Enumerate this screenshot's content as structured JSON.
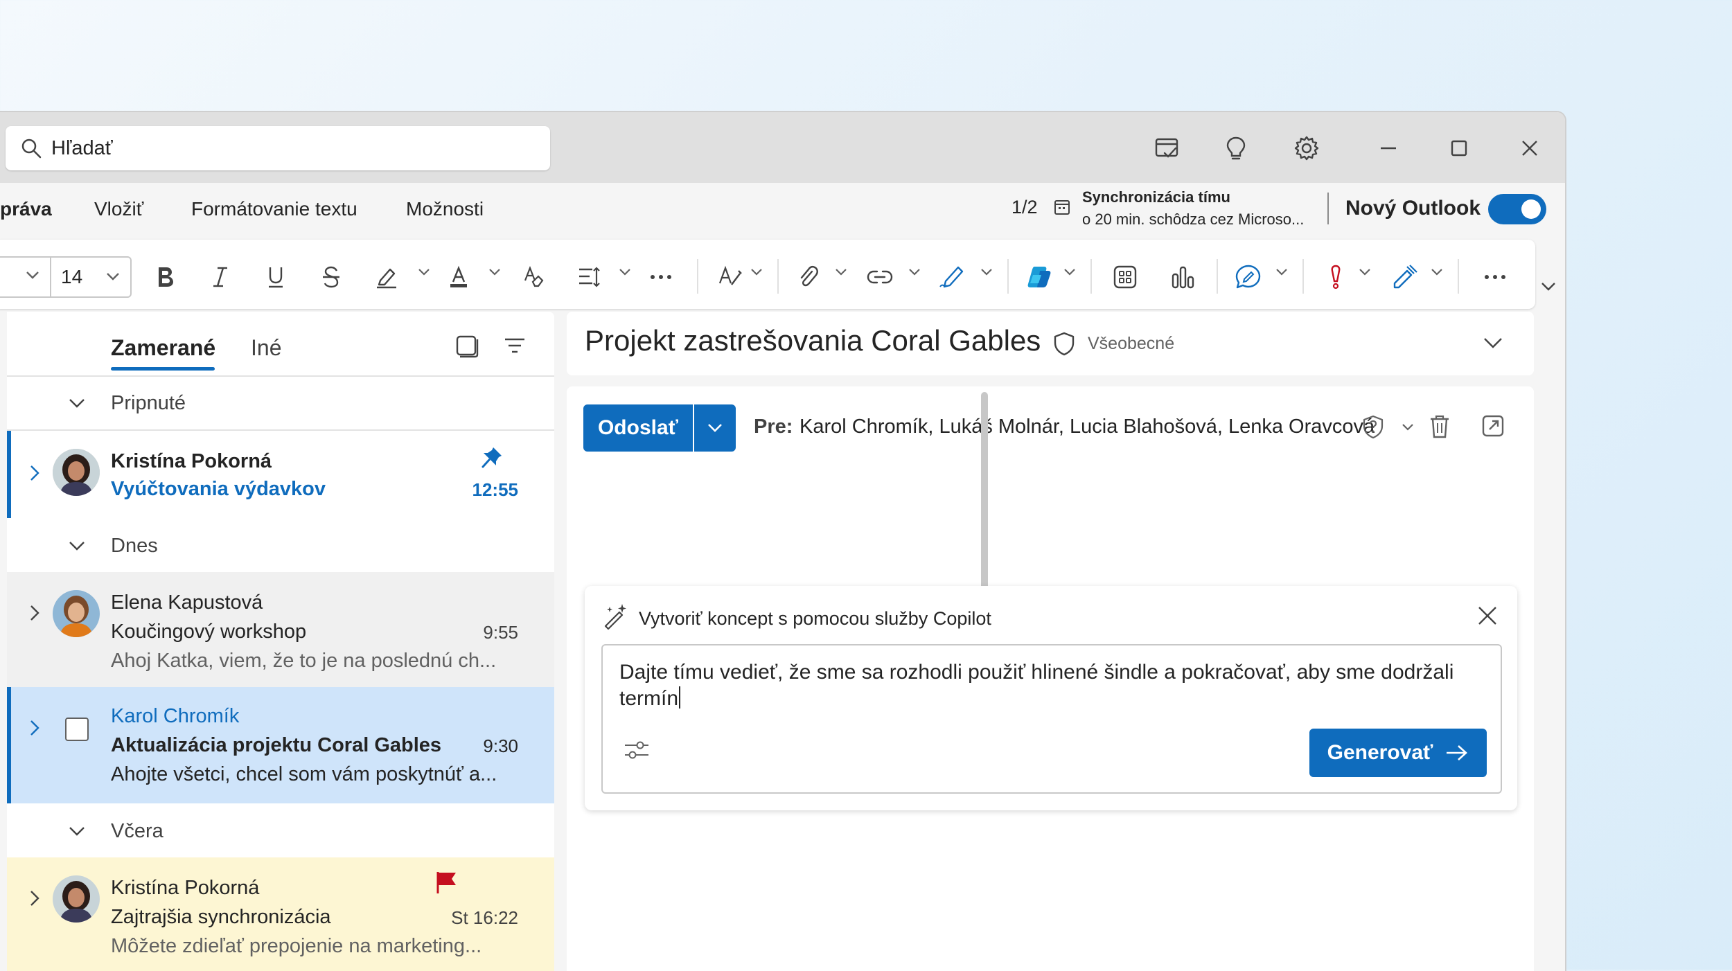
{
  "search": {
    "placeholder": "Hľadať"
  },
  "window_controls": [
    "minimize",
    "maximize",
    "close"
  ],
  "ribbon": {
    "tabs": [
      "práva",
      "Vložiť",
      "Formátovanie textu",
      "Možnosti"
    ],
    "active_tab": "práva",
    "counter": "1/2",
    "sync_title": "Synchronizácia tímu",
    "sync_subtitle": "o 20 min. schôdza cez Microso...",
    "new_outlook_label": "Nový Outlook",
    "new_outlook_enabled": true,
    "font_size": "14"
  },
  "maillist": {
    "tabs": [
      "Zamerané",
      "Iné"
    ],
    "groups": {
      "pinned": "Pripnuté",
      "today": "Dnes",
      "yesterday": "Včera"
    },
    "items": [
      {
        "sender": "Kristína Pokorná",
        "subject": "Vyúčtovania výdavkov",
        "time": "12:55",
        "pinned": true,
        "unread": true
      },
      {
        "sender": "Elena Kapustová",
        "subject": "Koučingový workshop",
        "time": "9:55",
        "preview": "Ahoj Katka, viem, že to je na poslednú ch..."
      },
      {
        "sender": "Karol Chromík",
        "subject": "Aktualizácia projektu Coral Gables",
        "time": "9:30",
        "preview": "Ahojte všetci, chcel som vám poskytnúť a...",
        "selected": true
      },
      {
        "sender": "Kristína Pokorná",
        "subject": "Zajtrajšia synchronizácia",
        "time": "St 16:22",
        "preview": "Môžete zdieľať prepojenie na marketing...",
        "flagged": true
      }
    ]
  },
  "reading": {
    "subject": "Projekt zastrešovania Coral Gables",
    "sensitivity": "Všeobecné",
    "send_label": "Odoslať",
    "to_label": "Pre:",
    "to_value": "Karol Chromík, Lukáš Molnár, Lucia Blahošová, Lenka Oravcová"
  },
  "copilot": {
    "title": "Vytvoriť koncept s pomocou služby Copilot",
    "prompt": "Dajte tímu vedieť, že sme sa rozhodli použiť hlinené šindle a pokračovať, aby sme dodržali termín",
    "generate_label": "Generovať"
  },
  "colors": {
    "accent": "#0f6cbd",
    "selected_item": "#cfe4fa",
    "flagged_item": "#fdf6d3",
    "flag": "#c50f1f",
    "titlebar": "#e0e0e0"
  }
}
